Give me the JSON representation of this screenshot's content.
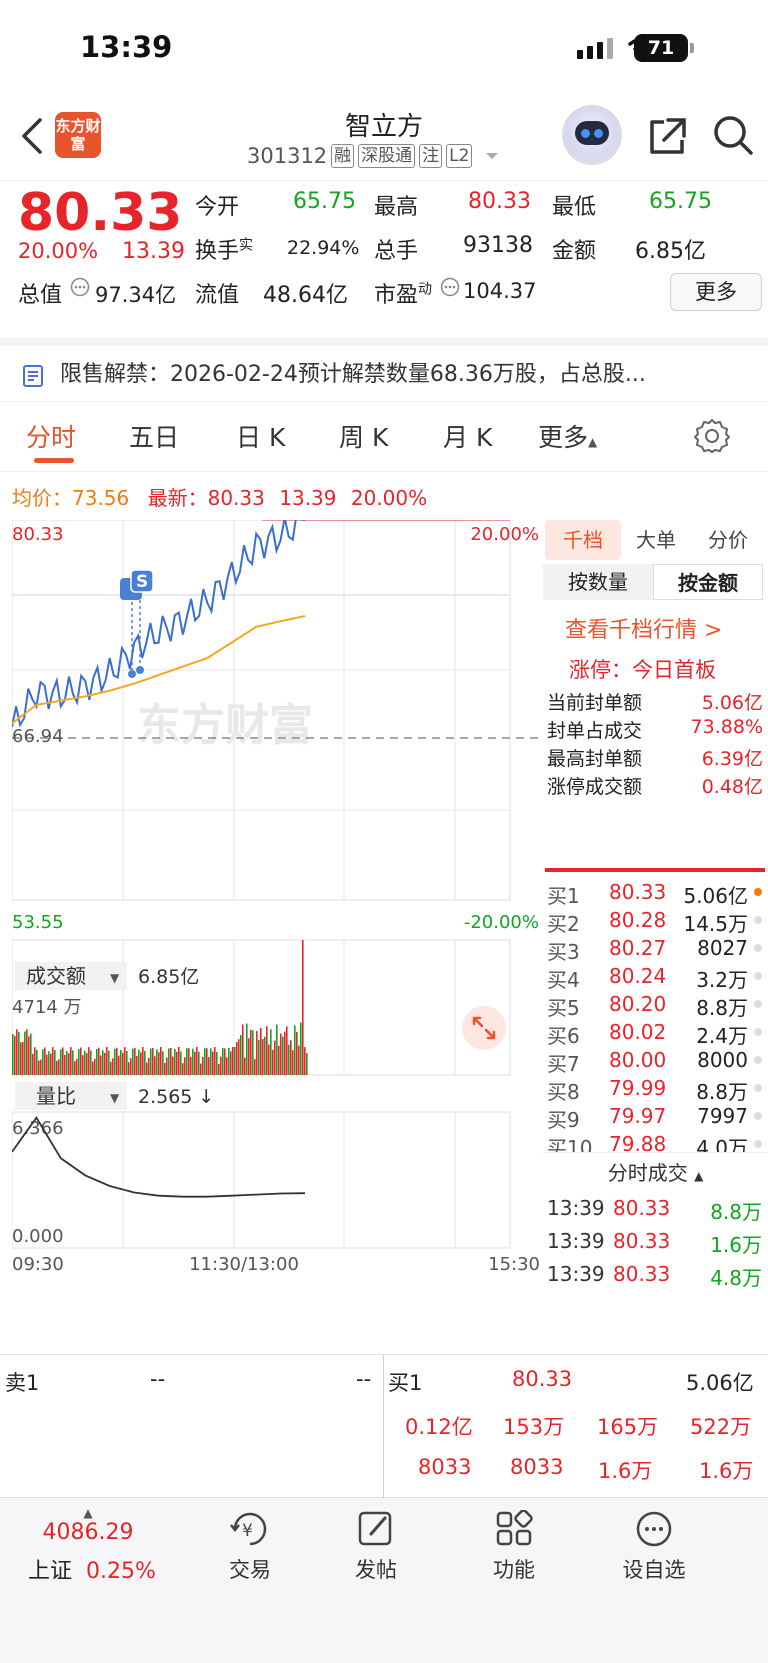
{
  "status": {
    "time": "13:39",
    "battery": "71"
  },
  "header": {
    "logo_text": "东方财富",
    "stock_name": "智立方",
    "stock_code": "301312",
    "tags": [
      "融",
      "深股通",
      "注",
      "L2"
    ]
  },
  "quote": {
    "price": "80.33",
    "change_pct": "20.00%",
    "change": "13.39",
    "open_label": "今开",
    "open": "65.75",
    "high_label": "最高",
    "high": "80.33",
    "low_label": "最低",
    "low": "65.75",
    "turnover_label": "换手",
    "turnover_sup": "实",
    "turnover": "22.94%",
    "volume_label": "总手",
    "volume": "93138",
    "amount_label": "金额",
    "amount": "6.85亿",
    "mktcap_label": "总值",
    "mktcap": "97.34亿",
    "float_label": "流值",
    "float": "48.64亿",
    "pe_label": "市盈",
    "pe_sup": "动",
    "pe": "104.37",
    "more_label": "更多"
  },
  "notice": {
    "text": "限售解禁：2026-02-24预计解禁数量68.36万股，占总股..."
  },
  "tabs": [
    {
      "label": "分时"
    },
    {
      "label": "五日"
    },
    {
      "label": "日 K"
    },
    {
      "label": "周 K"
    },
    {
      "label": "月 K"
    },
    {
      "label": "更多"
    }
  ],
  "intraday": {
    "avg_label": "均价：",
    "avg": "73.56",
    "latest_label": "最新：",
    "latest": "80.33",
    "latest_change": "13.39",
    "latest_pct": "20.00%",
    "y_top": "80.33",
    "y_mid": "66.94",
    "y_bottom": "53.55",
    "pct_top": "20.00%",
    "pct_bottom": "-20.00%",
    "watermark": "东方财富",
    "event_marker": "S",
    "amount_selector": "成交额",
    "amount_value": "6.85亿",
    "amount_max": "4714 万",
    "ratio_selector": "量比",
    "ratio_value": "2.565 ↓",
    "ratio_max": "6.366",
    "ratio_min": "0.000",
    "time_start": "09:30",
    "time_mid": "11:30/13:00",
    "time_end": "15:30"
  },
  "chart_data": {
    "type": "line",
    "xlabel": "",
    "ylabel": "",
    "x_times": [
      "09:30",
      "09:45",
      "10:00",
      "10:15",
      "10:30",
      "10:45",
      "11:00",
      "11:15",
      "11:30",
      "13:00",
      "13:15",
      "13:30",
      "13:39"
    ],
    "ylim": [
      53.55,
      80.33
    ],
    "series": [
      {
        "values": [
          65.75,
          68.2,
          68.0,
          68.6,
          69.5,
          71.2,
          72.4,
          73.3,
          74.6,
          76.4,
          78.5,
          79.2,
          80.33
        ]
      },
      {
        "values": [
          66.0,
          67.3,
          67.6,
          67.9,
          68.3,
          68.8,
          69.4,
          70.0,
          70.6,
          71.7,
          72.8,
          73.2,
          73.56
        ]
      }
    ],
    "volume_ratio": {
      "ylim": [
        0,
        6.366
      ],
      "values": [
        4.5,
        6.1,
        4.2,
        3.4,
        2.9,
        2.6,
        2.45,
        2.4,
        2.4,
        2.45,
        2.5,
        2.55,
        2.565
      ]
    }
  },
  "right_panel": {
    "segments": [
      "千档",
      "大单",
      "分价"
    ],
    "sub": [
      "按数量",
      "按金额"
    ],
    "link": "查看千档行情 >",
    "limit_title": "涨停：今日首板",
    "stats": [
      {
        "label": "当前封单额",
        "value": "5.06亿"
      },
      {
        "label": "封单占成交",
        "value": "73.88%"
      },
      {
        "label": "最高封单额",
        "value": "6.39亿"
      },
      {
        "label": "涨停成交额",
        "value": "0.48亿"
      }
    ],
    "bids": [
      {
        "label": "买1",
        "price": "80.33",
        "vol": "5.06亿"
      },
      {
        "label": "买2",
        "price": "80.28",
        "vol": "14.5万"
      },
      {
        "label": "买3",
        "price": "80.27",
        "vol": "8027"
      },
      {
        "label": "买4",
        "price": "80.24",
        "vol": "3.2万"
      },
      {
        "label": "买5",
        "price": "80.20",
        "vol": "8.8万"
      },
      {
        "label": "买6",
        "price": "80.02",
        "vol": "2.4万"
      },
      {
        "label": "买7",
        "price": "80.00",
        "vol": "8000"
      },
      {
        "label": "买8",
        "price": "79.99",
        "vol": "8.8万"
      },
      {
        "label": "买9",
        "price": "79.97",
        "vol": "7997"
      },
      {
        "label": "买10",
        "price": "79.88",
        "vol": "4.0万"
      }
    ],
    "ticks_title": "分时成交",
    "ticks": [
      {
        "time": "13:39",
        "price": "80.33",
        "vol": "8.8万"
      },
      {
        "time": "13:39",
        "price": "80.33",
        "vol": "1.6万"
      },
      {
        "time": "13:39",
        "price": "80.33",
        "vol": "4.8万"
      }
    ]
  },
  "book": {
    "sell_label": "卖1",
    "sell_price": "--",
    "sell_vol": "--",
    "buy_label": "买1",
    "buy_price": "80.33",
    "buy_vol": "5.06亿",
    "row2": [
      "0.12亿",
      "153万",
      "165万",
      "522万"
    ],
    "row3": [
      "8033",
      "8033",
      "1.6万",
      "1.6万"
    ]
  },
  "tabbar": {
    "index_value": "4086.29",
    "index_name": "上证",
    "index_pct": "0.25%",
    "items": [
      "交易",
      "发帖",
      "功能",
      "设自选"
    ]
  }
}
